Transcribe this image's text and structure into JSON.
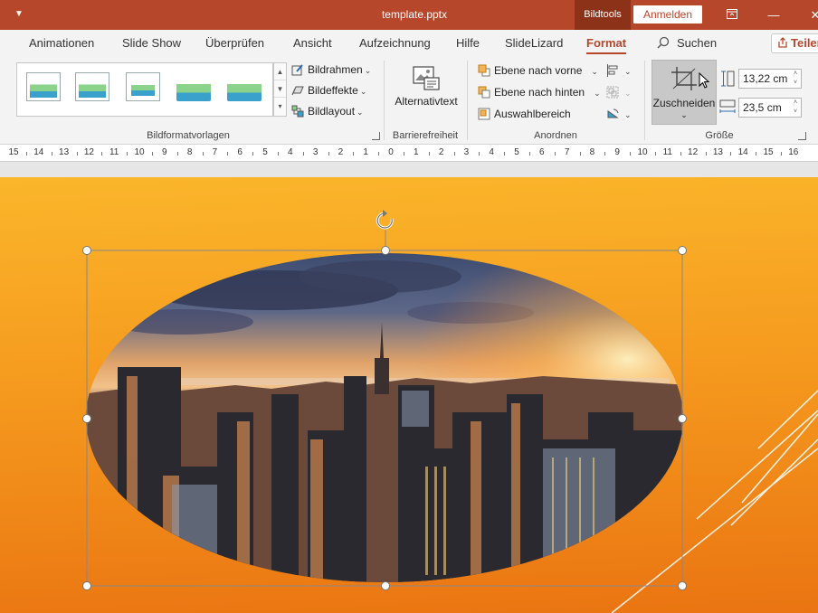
{
  "titlebar": {
    "qa_icon": "customize-icon",
    "title": "template.pptx",
    "context_tab": "Bildtools",
    "signin": "Anmelden",
    "window_buttons": [
      "restore-ribbon-icon",
      "minimize-icon",
      "close-icon"
    ]
  },
  "tabs": {
    "items": [
      "Animationen",
      "Slide Show",
      "Überprüfen",
      "Ansicht",
      "Aufzeichnung",
      "Hilfe",
      "SlideLizard",
      "Format"
    ],
    "active": "Format",
    "search": "Suchen",
    "share": "Teilen"
  },
  "ribbon": {
    "styles_group": {
      "label": "Bildformatvorlagen",
      "frame": "Bildrahmen",
      "effects": "Bildeffekte",
      "layout": "Bildlayout"
    },
    "accessibility_group": {
      "label": "Barrierefreiheit",
      "alt_text": "Alternativtext"
    },
    "arrange_group": {
      "label": "Anordnen",
      "bring_forward": "Ebene nach vorne",
      "send_backward": "Ebene nach hinten",
      "selection_pane": "Auswahlbereich"
    },
    "size_group": {
      "label": "Größe",
      "crop": "Zuschneiden",
      "height": "13,22 cm",
      "width": "23,5 cm"
    }
  },
  "ruler": {
    "labels": [
      "15",
      "14",
      "13",
      "12",
      "11",
      "10",
      "9",
      "8",
      "7",
      "6",
      "5",
      "4",
      "3",
      "2",
      "1",
      "0",
      "1",
      "2",
      "3",
      "4",
      "5",
      "6",
      "7",
      "8",
      "9",
      "10",
      "11",
      "12",
      "13",
      "14",
      "15",
      "16"
    ]
  },
  "colors": {
    "accent": "#b7472a",
    "slide_top": "#fbb62b",
    "slide_bottom": "#ea7412"
  }
}
